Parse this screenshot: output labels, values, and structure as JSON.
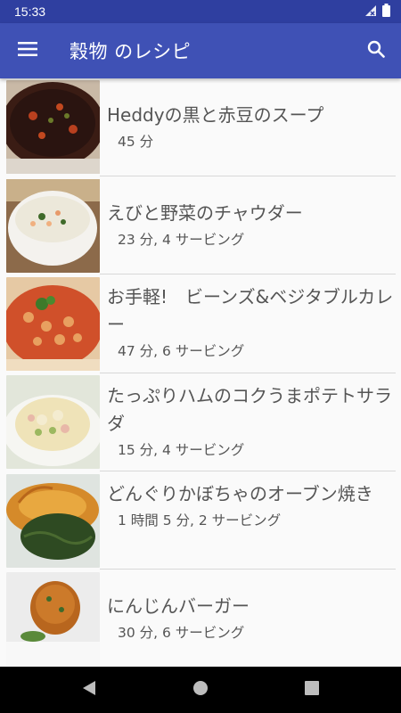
{
  "status_bar": {
    "time": "15:33"
  },
  "app_bar": {
    "title": "穀物 のレシピ"
  },
  "recipes": [
    {
      "title": "Heddyの黒と赤豆のスープ",
      "subtitle": "45 分"
    },
    {
      "title": "えびと野菜のチャウダー",
      "subtitle": "23 分, 4 サービング"
    },
    {
      "title": "お手軽!　ビーンズ&ベジタブルカレー",
      "subtitle": "47 分, 6 サービング"
    },
    {
      "title": "たっぷりハムのコクうまポテトサラダ",
      "subtitle": "15 分, 4 サービング"
    },
    {
      "title": "どんぐりかぼちゃのオーブン焼き",
      "subtitle": "1 時間 5 分, 2 サービング"
    },
    {
      "title": "にんじんバーガー",
      "subtitle": "30 分, 6 サービング"
    }
  ],
  "icons": {
    "menu": "menu-icon",
    "search": "search-icon",
    "signal": "signal-icon",
    "battery": "battery-icon",
    "back": "back-icon",
    "home": "home-icon",
    "recents": "recents-icon"
  },
  "colors": {
    "primary": "#3f51b5",
    "primary_dark": "#2f3fa0",
    "background": "#fafafa",
    "text": "#555555"
  }
}
